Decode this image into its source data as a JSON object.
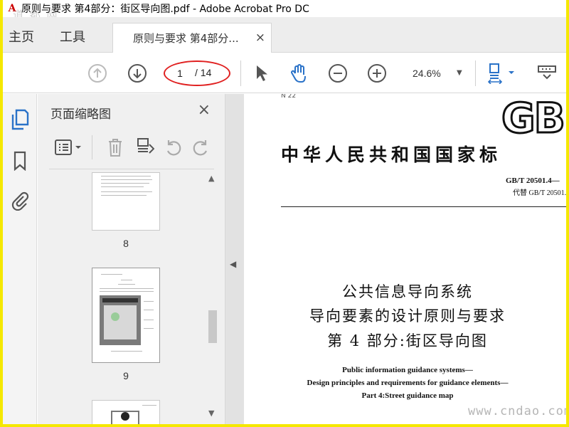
{
  "window": {
    "title": "原则与要求 第4部分：街区导向图.pdf - Adobe Acrobat Pro DC",
    "logo_glyph": "A",
    "watermark_top": "道 都 网",
    "watermark_bottom": "www.cndao.com"
  },
  "menu": {
    "home": "主页",
    "tools": "工具"
  },
  "tab": {
    "label": "原则与要求 第4部分...",
    "close": "×"
  },
  "toolbar": {
    "page_current": "1",
    "page_total": "/ 14",
    "zoom": "24.6%",
    "icons": [
      "arrow-up-icon",
      "arrow-down-icon",
      "pointer-icon",
      "hand-icon",
      "zoom-out-icon",
      "zoom-in-icon",
      "fit-width-icon",
      "scroll-mode-icon"
    ]
  },
  "rail": {
    "icons": [
      "page-thumbnails-icon",
      "bookmark-icon",
      "attachment-icon"
    ]
  },
  "thumbnails_panel": {
    "title": "页面缩略图",
    "close": "×",
    "pages": [
      {
        "label": "8"
      },
      {
        "label": "9"
      }
    ]
  },
  "document": {
    "ics": "N 22",
    "gb_logo": "GB",
    "national_standard": "中华人民共和国国家标",
    "number": "GB/T 20501.4—",
    "replaces": "代替 GB/T 20501.",
    "title_cn": [
      "公共信息导向系统",
      "导向要素的设计原则与要求",
      "第 4 部分:街区导向图"
    ],
    "title_en": [
      "Public information guidance systems—",
      "Design principles and requirements for guidance elements—",
      "Part 4:Street guidance map"
    ]
  },
  "colors": {
    "accent_blue": "#2a72c8",
    "annotation_red": "#e02020",
    "frame_yellow": "#f5e800"
  }
}
